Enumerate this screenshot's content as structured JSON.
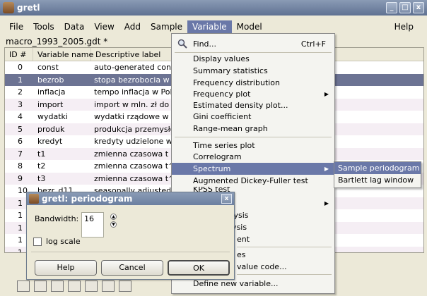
{
  "window": {
    "title": "gretl",
    "buttons": [
      "_",
      "□",
      "x"
    ]
  },
  "menubar": {
    "items": [
      "File",
      "Tools",
      "Data",
      "View",
      "Add",
      "Sample",
      "Variable",
      "Model"
    ],
    "help": "Help",
    "active": "Variable"
  },
  "file_label": "macro_1993_2005.gdt *",
  "table": {
    "headers": [
      "ID #",
      "Variable name",
      "Descriptive label"
    ],
    "rows": [
      {
        "id": "0",
        "name": "const",
        "label": "auto-generated const"
      },
      {
        "id": "1",
        "name": "bezrob",
        "label": "stopa bezrobocia w Po"
      },
      {
        "id": "2",
        "name": "inflacja",
        "label": "tempo inflacja w Polsc"
      },
      {
        "id": "3",
        "name": "import",
        "label": "import w mln. zł do Po"
      },
      {
        "id": "4",
        "name": "wydatki",
        "label": "wydatki rządowe w m"
      },
      {
        "id": "5",
        "name": "produk",
        "label": "produkcja przemysłow"
      },
      {
        "id": "6",
        "name": "kredyt",
        "label": "kredyty udzielone w n"
      },
      {
        "id": "7",
        "name": "t1",
        "label": "zmienna czasowa t"
      },
      {
        "id": "8",
        "name": "t2",
        "label": "zmienna czasowa t^2"
      },
      {
        "id": "9",
        "name": "t3",
        "label": "zmienna czasowa t^3"
      },
      {
        "id": "10",
        "name": "bezr_d11",
        "label": "seasonally adjusted b"
      },
      {
        "id": "1",
        "name": "",
        "label": ""
      },
      {
        "id": "1",
        "name": "",
        "label": ""
      },
      {
        "id": "1",
        "name": "",
        "label": ""
      },
      {
        "id": "1",
        "name": "",
        "label": ""
      },
      {
        "id": "1",
        "name": "",
        "label": ""
      }
    ],
    "selected_index": 1
  },
  "variable_menu": {
    "find": "Find...",
    "find_shortcut": "Ctrl+F",
    "items": [
      "Display values",
      "Summary statistics",
      "Frequency distribution",
      "Frequency plot",
      "Estimated density plot...",
      "Gini coefficient",
      "Range-mean graph",
      "Time series plot",
      "Correlogram",
      "Spectrum",
      "Augmented Dickey-Fuller test",
      "KPSS test",
      "",
      "analysis",
      "lysis",
      "ent",
      "es",
      "value code...",
      "Define new variable..."
    ]
  },
  "spectrum_submenu": [
    "Sample periodogram",
    "Bartlett lag window"
  ],
  "dialog": {
    "title": "gretl: periodogram",
    "bandwidth_label": "Bandwidth:",
    "bandwidth_value": "16",
    "log_scale_label": "log scale",
    "help_button": "Help",
    "cancel_button": "Cancel",
    "ok_button": "OK"
  }
}
